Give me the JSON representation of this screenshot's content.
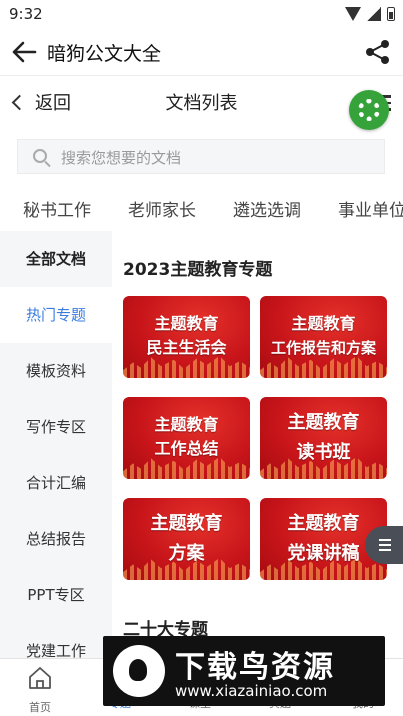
{
  "status_bar": {
    "time": "9:32"
  },
  "app_bar": {
    "title": "暗狗公文大全"
  },
  "sub_header": {
    "back_label": "返回",
    "title": "文档列表"
  },
  "search": {
    "placeholder": "搜索您想要的文档"
  },
  "category_tabs": [
    "秘书工作",
    "老师家长",
    "遴选选调",
    "事业单位"
  ],
  "sidebar": {
    "items": [
      "全部文档",
      "热门专题",
      "模板资料",
      "写作专区",
      "合计汇编",
      "总结报告",
      "PPT专区",
      "党建工作"
    ],
    "active_index": 1
  },
  "sections": [
    {
      "title": "2023主题教育专题",
      "cards": [
        {
          "line1": "主题教育",
          "line2": "民主生活会"
        },
        {
          "line1": "主题教育",
          "line2": "工作报告和方案"
        },
        {
          "line1": "主题教育",
          "line2": "工作总结"
        },
        {
          "line1": "主题教育",
          "line2": "读书班"
        },
        {
          "line1": "主题教育",
          "line2": "方案"
        },
        {
          "line1": "主题教育",
          "line2": "党课讲稿"
        }
      ]
    },
    {
      "title": "二十大专题"
    }
  ],
  "bottom_nav": [
    {
      "label": "首页",
      "icon": "home-icon"
    },
    {
      "label": "专题",
      "icon": "topic-icon"
    },
    {
      "label": "课堂",
      "icon": "classroom-icon"
    },
    {
      "label": "真题",
      "icon": "exam-icon"
    },
    {
      "label": "我的",
      "icon": "profile-icon"
    }
  ],
  "watermark": {
    "title": "下载鸟资源",
    "url": "www.xiazainiao.com"
  },
  "colors": {
    "accent_blue": "#3a7de0",
    "card_red": "#c8151a",
    "green_badge": "#35a33a"
  }
}
